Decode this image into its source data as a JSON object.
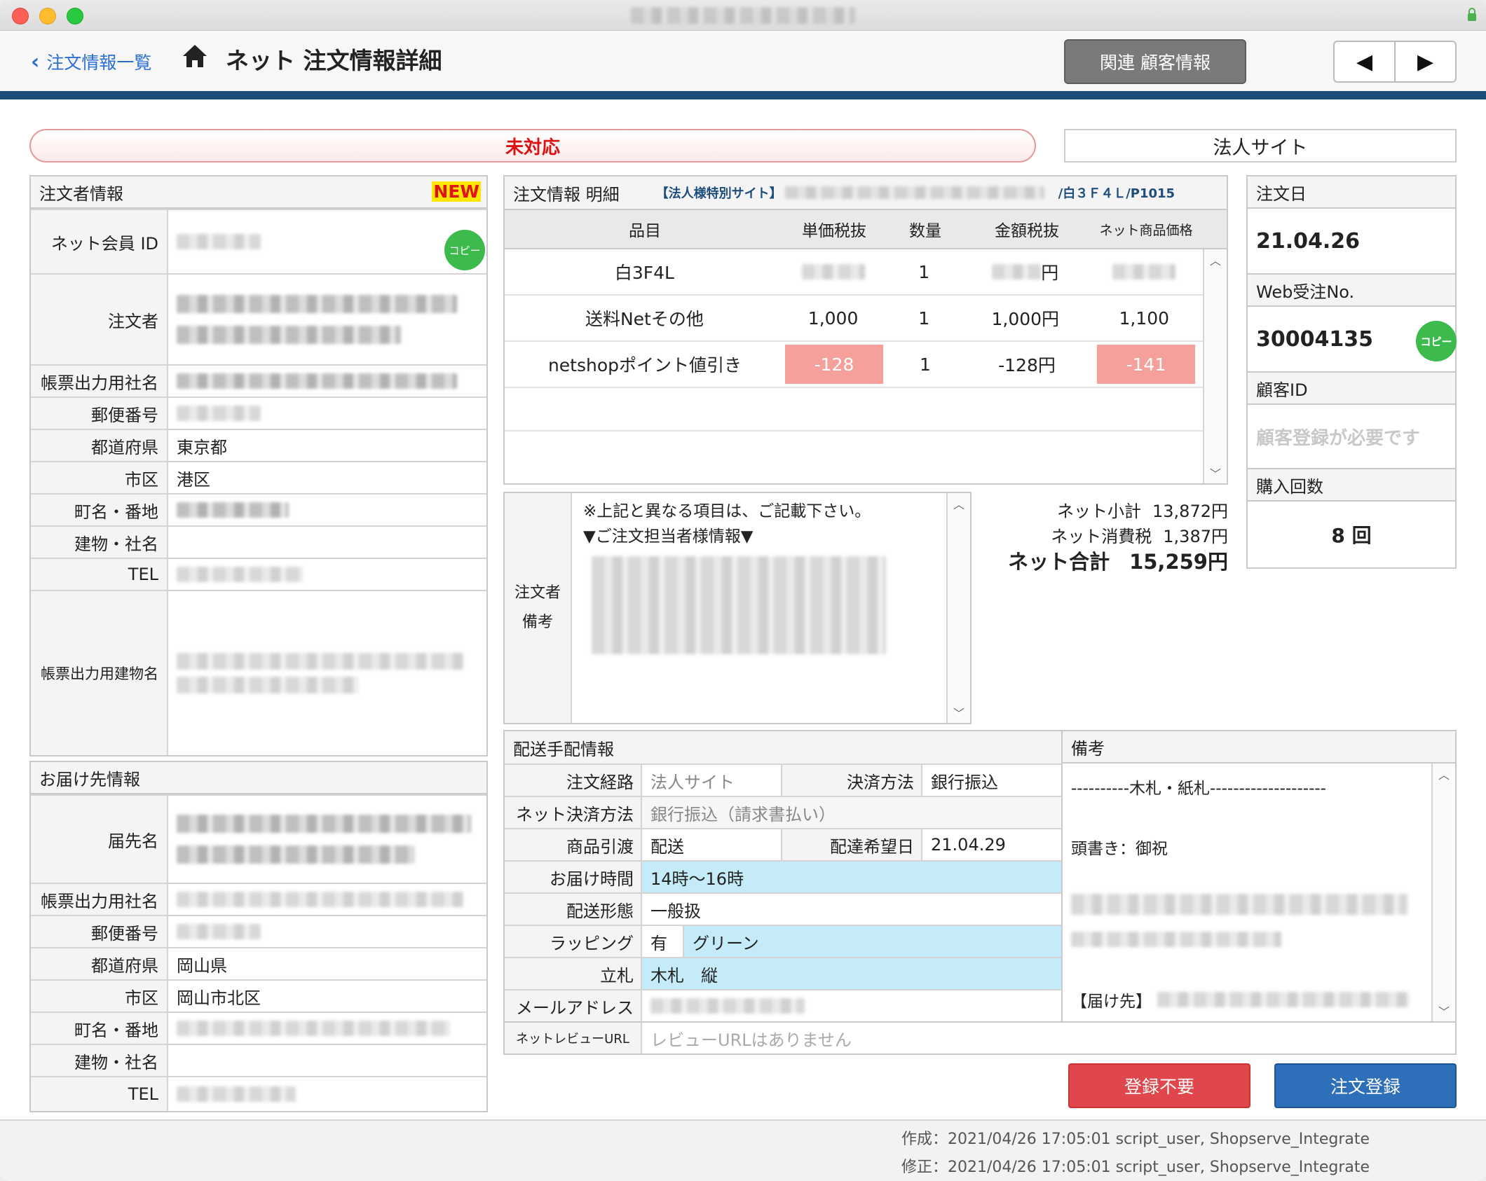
{
  "window": {
    "title_blurred": true
  },
  "nav": {
    "back_label": "注文情報一覧",
    "title": "ネット 注文情報詳細",
    "related_button": "関連 顧客情報",
    "prev_icon": "◀",
    "next_icon": "▶"
  },
  "status": {
    "label": "未対応",
    "site": "法人サイト"
  },
  "orderer": {
    "header": "注文者情報",
    "new_badge": "NEW",
    "copy_label": "コピー",
    "labels": {
      "member_id": "ネット会員 ID",
      "name": "注文者",
      "invoice_company": "帳票出力用社名",
      "zip": "郵便番号",
      "pref": "都道府県",
      "city": "市区",
      "town": "町名・番地",
      "building": "建物・社名",
      "tel": "TEL",
      "invoice_building": "帳票出力用建物名"
    },
    "values": {
      "pref": "東京都",
      "city": "港区"
    }
  },
  "delivery": {
    "header": "お届け先情報",
    "labels": {
      "name": "届先名",
      "invoice_company": "帳票出力用社名",
      "zip": "郵便番号",
      "pref": "都道府県",
      "city": "市区",
      "town": "町名・番地",
      "building": "建物・社名",
      "tel": "TEL"
    },
    "values": {
      "pref": "岡山県",
      "city": "岡山市北区"
    }
  },
  "order": {
    "header": "注文情報 明細",
    "site_tag": "【法人様特別サイト】",
    "site_suffix": "/白３Ｆ４Ｌ/P1015",
    "columns": [
      "品目",
      "単価税抜",
      "数量",
      "金額税抜",
      "ネット商品価格"
    ],
    "rows": [
      {
        "item": "白3F4L",
        "price": "",
        "qty": "1",
        "amount": "円",
        "net": ""
      },
      {
        "item": "送料Netその他",
        "price": "1,000",
        "qty": "1",
        "amount": "1,000円",
        "net": "1,100"
      },
      {
        "item": "netshopポイント値引き",
        "price": "-128",
        "qty": "1",
        "amount": "-128円",
        "net": "-141"
      }
    ]
  },
  "memo": {
    "label1": "注文者",
    "label2": "備考",
    "line1": "※上記と異なる項目は、ご記載下さい。",
    "line2": "▼ご注文担当者様情報▼"
  },
  "totals": {
    "subtotal_label": "ネット小計",
    "subtotal": "13,872円",
    "tax_label": "ネット消費税",
    "tax": "1,387円",
    "total_label": "ネット合計",
    "total": "15,259円"
  },
  "side": {
    "order_date_label": "注文日",
    "order_date": "21.04.26",
    "web_no_label": "Web受注No.",
    "web_no": "30004135",
    "customer_id_label": "顧客ID",
    "customer_id_placeholder": "顧客登録が必要です",
    "purchase_count_label": "購入回数",
    "purchase_count": "8 回",
    "copy_label": "コピー"
  },
  "shipping": {
    "header": "配送手配情報",
    "route_label": "注文経路",
    "route": "法人サイト",
    "payment_label": "決済方法",
    "payment": "銀行振込",
    "net_payment_label": "ネット決済方法",
    "net_payment": "銀行振込（請求書払い）",
    "handover_label": "商品引渡",
    "handover": "配送",
    "desired_date_label": "配達希望日",
    "desired_date": "21.04.29",
    "time_label": "お届け時間",
    "time": "14時〜16時",
    "form_label": "配送形態",
    "form": "一般扱",
    "wrapping_label": "ラッピング",
    "wrapping": "有",
    "wrapping_color": "グリーン",
    "tag_label": "立札",
    "tag": "木札　縦",
    "email_label": "メールアドレス",
    "review_label": "ネットレビューURL",
    "review_placeholder": "レビューURLはありません"
  },
  "notes": {
    "header": "備考",
    "line1": "----------木札・紙札--------------------",
    "line2": "頭書き：御祝",
    "line3": "【届け先】"
  },
  "actions": {
    "skip": "登録不要",
    "register": "注文登録"
  },
  "footer": {
    "created": "作成：2021/04/26 17:05:01 script_user, Shopserve_Integrate",
    "modified": "修正：2021/04/26 17:05:01 script_user, Shopserve_Integrate"
  },
  "colors": {
    "navy": "#1e4d7c",
    "red": "#e0474c",
    "blue": "#2e6fba",
    "green": "#3cbb4c",
    "highlight": "#c5ebf8",
    "negative": "#f6a09c"
  }
}
